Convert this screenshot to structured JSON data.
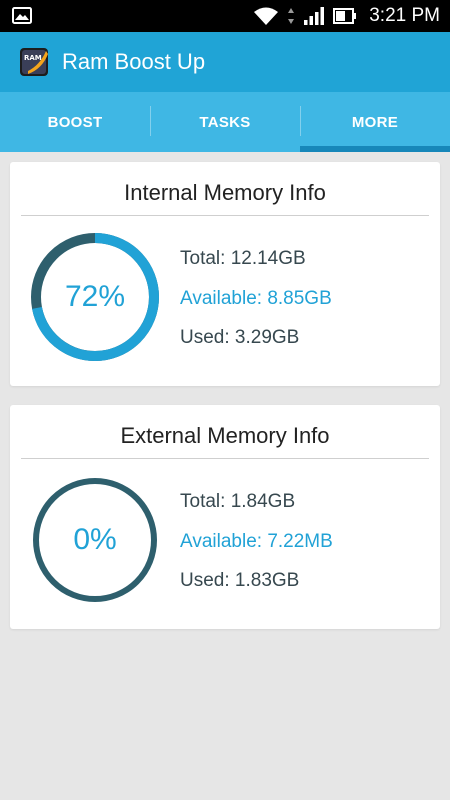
{
  "status_bar": {
    "time": "3:21 PM",
    "icons": [
      "image-icon",
      "wifi-icon",
      "data-arrows-icon",
      "signal-icon",
      "battery-icon"
    ]
  },
  "app": {
    "title": "Ram Boost Up",
    "logo_text": "RAM",
    "icon": "app-logo-icon"
  },
  "tabs": [
    {
      "label": "BOOST",
      "active": false
    },
    {
      "label": "TASKS",
      "active": false
    },
    {
      "label": "MORE",
      "active": true
    }
  ],
  "internal": {
    "title": "Internal Memory Info",
    "percent_label": "72%",
    "used_fraction": 0.72,
    "total": "Total: 12.14GB",
    "available": "Available: 8.85GB",
    "used": "Used: 3.29GB"
  },
  "external": {
    "title": "External Memory Info",
    "percent_label": "0%",
    "used_fraction": 0.0,
    "total": "Total: 1.84GB",
    "available": "Available: 7.22MB",
    "used": "Used: 1.83GB"
  },
  "colors": {
    "accent": "#21a2d6",
    "app_bar": "#20a4d6",
    "tab_bar": "#3fb7e4",
    "ring_track": "#2e5f6d",
    "background": "#e6e6e6"
  }
}
